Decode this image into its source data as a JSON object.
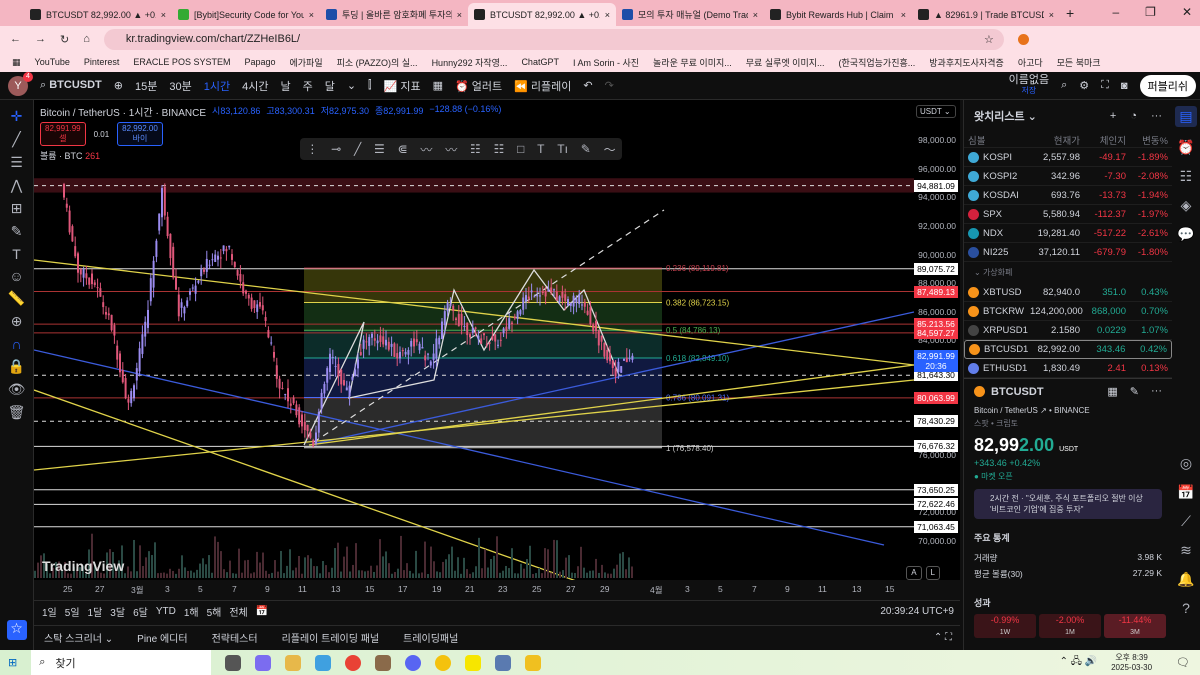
{
  "browser": {
    "tabs": [
      {
        "title": "BTCUSDT 82,992.00 ▲ +0.42%",
        "active": false
      },
      {
        "title": "[Bybit]Security Code for Your A",
        "active": false
      },
      {
        "title": "투딩 | 올바른 암호화폐 투자의",
        "active": false
      },
      {
        "title": "BTCUSDT 82,992.00 ▲ +0.42%",
        "active": true
      },
      {
        "title": "모의 투자 매뉴얼 (Demo Tradi",
        "active": false
      },
      {
        "title": "Bybit Rewards Hub | Claim ov",
        "active": false
      },
      {
        "title": "▲ 82961.9 | Trade BTCUSDT",
        "active": false
      }
    ],
    "url": "kr.tradingview.com/chart/ZZHeIB6L/",
    "bookmarks": [
      "YouTube",
      "Pinterest",
      "ERACLE POS SYSTEM",
      "Papago",
      "에가파일",
      "피소 (PAZZO)의 실...",
      "Hunny292 자작영...",
      "ChatGPT",
      "I Am Sorin - 사진",
      "놀라운 무료 이미지...",
      "무료 실루엣 이미지...",
      "(한국직업능가진흥...",
      "방과후지도사자격증",
      "아고다",
      "모든 북마크"
    ]
  },
  "toolbar": {
    "avatar": "Y",
    "avatar_badge": "4",
    "symbol": "BTCUSDT",
    "intervals": [
      "15분",
      "30분",
      "1시간",
      "4시간",
      "날",
      "주",
      "달"
    ],
    "selected_interval": "1시간",
    "indicators": "지표",
    "alert": "얼러트",
    "replay": "리플레이",
    "layout_name": "이름없음",
    "layout_sub": "저장",
    "publish": "퍼블리쉬"
  },
  "legend": {
    "title": "Bitcoin / TetherUS · 1시간 · BINANCE",
    "open": "시83,120.86",
    "high": "고83,300.31",
    "low": "저82,975.30",
    "close": "종82,991.99",
    "change": "−128.88 (−0.16%)",
    "sell_price": "82,991.99",
    "sell_label": "셀",
    "spread": "0.01",
    "buy_price": "82,992.00",
    "buy_label": "바이",
    "volume_label": "볼륨 · BTC",
    "volume_value": "261"
  },
  "axis": {
    "currency": "USDT",
    "ticks": [
      "98,000.00",
      "96,000.00",
      "94,000.00",
      "92,000.00",
      "90,000.00",
      "88,000.00",
      "86,000.00",
      "84,000.00",
      "76,000.00",
      "72,000.00",
      "70,000.00"
    ],
    "current_price": "82,991.99",
    "countdown": "20:36",
    "auto": "A",
    "log": "L"
  },
  "chart_data": {
    "type": "candlestick",
    "symbol": "BTCUSDT",
    "interval": "1h",
    "ylim": [
      69000,
      100000
    ],
    "x_labels": [
      "25",
      "27",
      "3월",
      "3",
      "5",
      "7",
      "9",
      "11",
      "13",
      "15",
      "17",
      "19",
      "21",
      "23",
      "25",
      "27",
      "29",
      "4월",
      "3",
      "5",
      "7",
      "9",
      "11",
      "13",
      "15"
    ],
    "approx_daily_close": [
      95000,
      89000,
      88000,
      85000,
      79500,
      85000,
      94500,
      86000,
      88000,
      90000,
      90500,
      87000,
      86000,
      81000,
      79000,
      77000,
      83000,
      80500,
      84000,
      84300,
      83000,
      84000,
      82500,
      86500,
      85000,
      84200,
      84000,
      86000,
      87500,
      87500,
      86800,
      87000,
      84000,
      82000,
      82992
    ],
    "levels": [
      {
        "price": 94881.09,
        "label": "94,881.09",
        "color": "#ffffff",
        "style": "dashed-red"
      },
      {
        "price": 89075.72,
        "label": "89,075.72",
        "color": "#ffffff",
        "style": "solid"
      },
      {
        "price": 87489.13,
        "label": "87,489.13",
        "color": "#f23645",
        "style": "solid"
      },
      {
        "price": 85213.56,
        "label": "85,213.56",
        "color": "#f23645",
        "style": "solid"
      },
      {
        "price": 84597.27,
        "label": "84,597.27",
        "color": "#f23645",
        "style": "solid"
      },
      {
        "price": 81643.3,
        "label": "81,643.30",
        "color": "#ffffff",
        "style": "dashed"
      },
      {
        "price": 80063.99,
        "label": "80,063.99",
        "color": "#f23645",
        "style": "solid"
      },
      {
        "price": 78430.29,
        "label": "78,430.29",
        "color": "#ffffff",
        "style": "dashed"
      },
      {
        "price": 76676.32,
        "label": "76,676.32",
        "color": "#ffffff",
        "style": "solid"
      },
      {
        "price": 73650.25,
        "label": "73,650.25",
        "color": "#ffffff",
        "style": "solid"
      },
      {
        "price": 72622.46,
        "label": "72,622.46",
        "color": "#ffffff",
        "style": "solid"
      },
      {
        "price": 71063.45,
        "label": "71,063.45",
        "color": "#ffffff",
        "style": "solid"
      }
    ],
    "fib": [
      {
        "price": 89119.81,
        "label": "0.236 (89,119.81)",
        "color": "#c2404e"
      },
      {
        "price": 86723.15,
        "label": "0.382 (86,723.15)",
        "color": "#e0d34a"
      },
      {
        "price": 84786.13,
        "label": "0.5 (84,786.13)",
        "color": "#4caf50"
      },
      {
        "price": 82849.1,
        "label": "0.618 (82,849.10)",
        "color": "#22ab94"
      },
      {
        "price": 80091.31,
        "label": "0.786 (80,091.31)",
        "color": "#4a6cf7"
      },
      {
        "price": 76578.4,
        "label": "1 (76,578.40)",
        "color": "#cccccc"
      }
    ]
  },
  "timeaxis": {
    "clock": "20:39:24 UTC+9"
  },
  "ranges": [
    "1일",
    "5일",
    "1달",
    "3달",
    "6달",
    "YTD",
    "1해",
    "5해",
    "전체"
  ],
  "bottom_tabs": [
    "스탁 스크리너",
    "Pine 에디터",
    "전략테스터",
    "리플레이 트레이딩 패널",
    "트레이딩패널"
  ],
  "watchlist": {
    "title": "왓치리스트",
    "headers": [
      "심볼",
      "현재가",
      "체인지",
      "변동%"
    ],
    "rows": [
      {
        "sym": "KOSPI",
        "price": "2,557.98",
        "chg": "-49.17",
        "pct": "-1.89%",
        "color": "#3fa9d6",
        "dir": "neg"
      },
      {
        "sym": "KOSPI2",
        "price": "342.96",
        "chg": "-7.30",
        "pct": "-2.08%",
        "color": "#3fa9d6",
        "dir": "neg"
      },
      {
        "sym": "KOSDAI",
        "price": "693.76",
        "chg": "-13.73",
        "pct": "-1.94%",
        "color": "#3fa9d6",
        "dir": "neg"
      },
      {
        "sym": "SPX",
        "price": "5,580.94",
        "chg": "-112.37",
        "pct": "-1.97%",
        "color": "#d4213d",
        "dir": "neg"
      },
      {
        "sym": "NDX",
        "price": "19,281.40",
        "chg": "-517.22",
        "pct": "-2.61%",
        "color": "#1796b0",
        "dir": "neg"
      },
      {
        "sym": "NI225",
        "price": "37,120.11",
        "chg": "-679.79",
        "pct": "-1.80%",
        "color": "#2a4f9e",
        "dir": "neg"
      }
    ],
    "section": "가상화폐",
    "crypto": [
      {
        "sym": "XBTUSD",
        "price": "82,940.0",
        "chg": "351.0",
        "pct": "0.43%",
        "color": "#f7931a",
        "dir": "pos"
      },
      {
        "sym": "BTCKRW",
        "price": "124,200,000",
        "chg": "868,000",
        "pct": "0.70%",
        "color": "#f7931a",
        "dir": "pos"
      },
      {
        "sym": "XRPUSD1",
        "price": "2.1580",
        "chg": "0.0229",
        "pct": "1.07%",
        "color": "#444",
        "dir": "pos"
      },
      {
        "sym": "BTCUSD1",
        "price": "82,992.00",
        "chg": "343.46",
        "pct": "0.42%",
        "color": "#f7931a",
        "dir": "pos"
      },
      {
        "sym": "ETHUSD1",
        "price": "1,830.49",
        "chg": "2.41",
        "pct": "0.13%",
        "color": "#627eea",
        "dir": "neg"
      }
    ]
  },
  "details": {
    "symbol": "BTCUSDT",
    "name": "Bitcoin / TetherUS",
    "exchange": "BINANCE",
    "type": "스팟 • 크립토",
    "price_main": "82,99",
    "price_tail": "2.00",
    "currency": "USDT",
    "change": "+343.46",
    "change_pct": "+0.42%",
    "market_status": "마켓 오픈",
    "news": "2시간 전 · \"오세훈, 주식 포트폴리오 절반 이상 '비트코인 기업'에 집중 투자\"",
    "stats_title": "주요 통계",
    "stats": [
      {
        "k": "거래량",
        "v": "3.98 K"
      },
      {
        "k": "평균 볼륨(30)",
        "v": "27.29 K"
      }
    ],
    "perf_title": "성과",
    "perf": [
      {
        "v": "-0.99%",
        "p": "1W"
      },
      {
        "v": "-2.00%",
        "p": "1M"
      },
      {
        "v": "-11.44%",
        "p": "3M"
      }
    ]
  },
  "taskbar": {
    "search": "찾기",
    "time": "오후 8:39",
    "date": "2025-03-30"
  },
  "watermark": "TradingView"
}
